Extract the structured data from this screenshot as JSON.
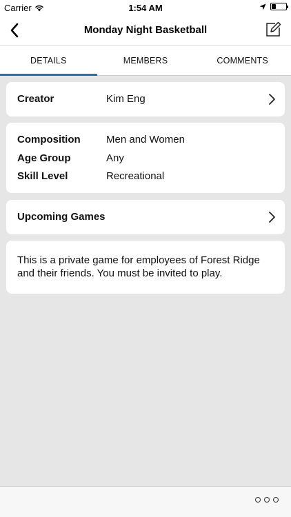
{
  "status": {
    "carrier": "Carrier",
    "time": "1:54 AM"
  },
  "nav": {
    "title": "Monday Night Basketball"
  },
  "tabs": [
    {
      "label": "DETAILS",
      "active": true
    },
    {
      "label": "MEMBERS",
      "active": false
    },
    {
      "label": "COMMENTS",
      "active": false
    }
  ],
  "creator": {
    "label": "Creator",
    "value": "Kim Eng"
  },
  "info": [
    {
      "label": "Composition",
      "value": "Men and Women"
    },
    {
      "label": "Age Group",
      "value": "Any"
    },
    {
      "label": "Skill Level",
      "value": "Recreational"
    }
  ],
  "games": {
    "label": "Upcoming Games"
  },
  "description": "This is a private game for employees of Forest Ridge and their friends. You must be invited to play.",
  "colors": {
    "accent": "#2d6ea8",
    "background": "#e6e6e6"
  }
}
